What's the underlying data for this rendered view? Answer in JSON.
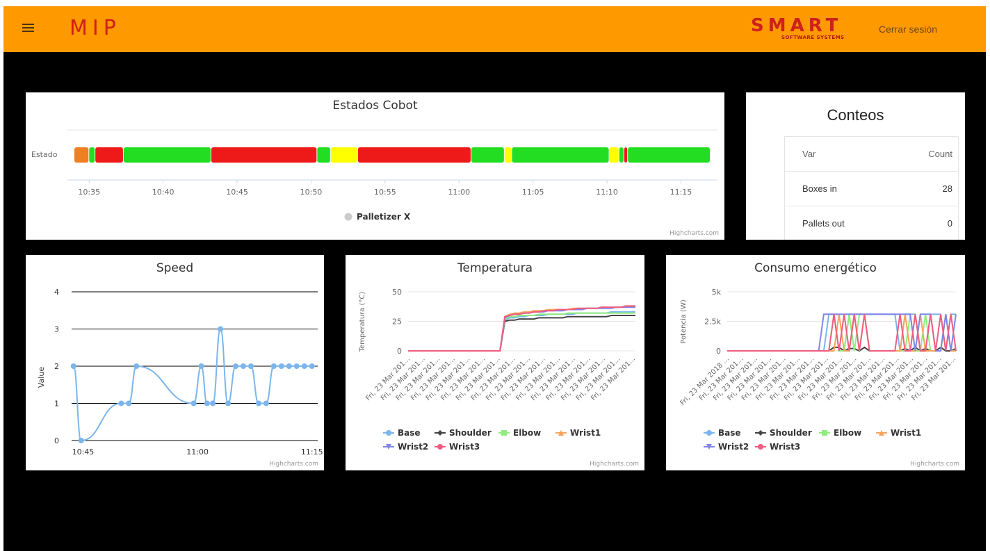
{
  "header": {
    "logo_left": "MIP",
    "logo_right_main": "SMART",
    "logo_right_sub": "Software Systems",
    "logout_label": "Cerrar sesión",
    "bar_color": "#ff9900"
  },
  "estados": {
    "title": "Estados Cobot",
    "category_label": "Estado",
    "legend_label": "Palletizer X",
    "credit": "Highcharts.com",
    "x_ticks": [
      "10:35",
      "10:40",
      "10:45",
      "10:50",
      "10:55",
      "11:00",
      "11:05",
      "11:10",
      "11:15"
    ],
    "chart_data": {
      "type": "bar",
      "orientation": "timeline",
      "x_range": [
        "10:34",
        "11:17"
      ],
      "segments": [
        {
          "start": "10:34:00",
          "end": "10:35:00",
          "color": "#ee7f22"
        },
        {
          "start": "10:35:00",
          "end": "10:35:25",
          "color": "#22dd22"
        },
        {
          "start": "10:35:25",
          "end": "10:37:20",
          "color": "#ee1a1a"
        },
        {
          "start": "10:37:20",
          "end": "10:43:15",
          "color": "#22dd22"
        },
        {
          "start": "10:43:15",
          "end": "10:50:25",
          "color": "#ee1a1a"
        },
        {
          "start": "10:50:25",
          "end": "10:51:20",
          "color": "#22dd22"
        },
        {
          "start": "10:51:20",
          "end": "10:53:10",
          "color": "#ffff00"
        },
        {
          "start": "10:53:10",
          "end": "11:00:50",
          "color": "#ee1a1a"
        },
        {
          "start": "11:00:50",
          "end": "11:03:05",
          "color": "#22dd22"
        },
        {
          "start": "11:03:05",
          "end": "11:03:35",
          "color": "#ffff00"
        },
        {
          "start": "11:03:35",
          "end": "11:10:10",
          "color": "#22dd22"
        },
        {
          "start": "11:10:10",
          "end": "11:10:50",
          "color": "#ffff00"
        },
        {
          "start": "11:10:50",
          "end": "11:11:10",
          "color": "#22dd22"
        },
        {
          "start": "11:11:10",
          "end": "11:11:25",
          "color": "#ee1a1a"
        },
        {
          "start": "11:11:25",
          "end": "11:17:00",
          "color": "#22dd22"
        }
      ]
    }
  },
  "conteos": {
    "title": "Conteos",
    "columns": [
      "Var",
      "Count"
    ],
    "rows": [
      {
        "var": "Boxes in",
        "count": "28"
      },
      {
        "var": "Pallets out",
        "count": "0"
      }
    ]
  },
  "speed": {
    "title": "Speed",
    "ylabel": "Value",
    "credit": "Highcharts.com",
    "chart_data": {
      "type": "line",
      "x_ticks": [
        "10:45",
        "11:00",
        "11:15"
      ],
      "y_ticks": [
        0,
        1,
        2,
        3,
        4
      ],
      "ylim": [
        0,
        4
      ],
      "xlim": [
        "10:43:30",
        "11:15:45"
      ],
      "series": [
        {
          "color": "#7cb5ec",
          "x": [
            "10:43:45",
            "10:44:45",
            "10:50:00",
            "10:51:00",
            "10:52:00",
            "10:59:30",
            "11:00:30",
            "11:01:15",
            "11:02:00",
            "11:03:00",
            "11:04:00",
            "11:05:00",
            "11:06:00",
            "11:07:00",
            "11:08:00",
            "11:09:00",
            "11:10:00",
            "11:11:00",
            "11:12:00",
            "11:13:00",
            "11:14:00",
            "11:15:00"
          ],
          "values": [
            2,
            0,
            1,
            1,
            2,
            1,
            2,
            1,
            1,
            3,
            1,
            2,
            2,
            2,
            1,
            1,
            2,
            2,
            2,
            2,
            2,
            2
          ]
        }
      ]
    }
  },
  "temperatura": {
    "title": "Temperatura",
    "ylabel": "Temperatura (°C)",
    "credit": "Highcharts.com",
    "x_tick_label": "Fri, 23 Mar 201...",
    "x_tick_count": 16,
    "legend": [
      {
        "name": "Base",
        "color": "#7cb5ec",
        "marker": "circle"
      },
      {
        "name": "Shoulder",
        "color": "#434348",
        "marker": "diamond"
      },
      {
        "name": "Elbow",
        "color": "#90ed7d",
        "marker": "square"
      },
      {
        "name": "Wrist1",
        "color": "#f7a35c",
        "marker": "triangle"
      },
      {
        "name": "Wrist2",
        "color": "#8085e9",
        "marker": "triangle-down"
      },
      {
        "name": "Wrist3",
        "color": "#f15c80",
        "marker": "circle"
      }
    ],
    "chart_data": {
      "type": "line",
      "y_ticks": [
        0,
        25,
        50
      ],
      "ylim": [
        0,
        50
      ],
      "series": [
        {
          "name": "Base",
          "values": [
            0,
            0,
            0,
            0,
            0,
            0,
            0,
            0,
            0,
            0,
            0,
            0,
            0,
            0,
            0,
            0,
            0,
            0,
            0,
            0,
            26,
            28,
            28,
            29,
            29,
            30,
            30,
            30,
            30,
            31,
            31,
            31,
            31,
            31,
            31,
            32,
            32,
            32,
            32,
            32,
            32,
            32,
            33,
            33,
            33,
            33,
            33,
            33
          ]
        },
        {
          "name": "Shoulder",
          "values": [
            0,
            0,
            0,
            0,
            0,
            0,
            0,
            0,
            0,
            0,
            0,
            0,
            0,
            0,
            0,
            0,
            0,
            0,
            0,
            0,
            25,
            26,
            26,
            27,
            27,
            27,
            27,
            28,
            28,
            28,
            28,
            28,
            28,
            29,
            29,
            29,
            29,
            29,
            29,
            29,
            29,
            29,
            30,
            30,
            30,
            30,
            30,
            30
          ]
        },
        {
          "name": "Elbow",
          "values": [
            0,
            0,
            0,
            0,
            0,
            0,
            0,
            0,
            0,
            0,
            0,
            0,
            0,
            0,
            0,
            0,
            0,
            0,
            0,
            0,
            27,
            29,
            29,
            30,
            30,
            30,
            30,
            31,
            31,
            31,
            31,
            31,
            31,
            32,
            32,
            32,
            32,
            32,
            32,
            32,
            32,
            32,
            32,
            32,
            32,
            32,
            32,
            32
          ]
        },
        {
          "name": "Wrist1",
          "values": [
            0,
            0,
            0,
            0,
            0,
            0,
            0,
            0,
            0,
            0,
            0,
            0,
            0,
            0,
            0,
            0,
            0,
            0,
            0,
            0,
            29,
            31,
            32,
            32,
            33,
            33,
            34,
            34,
            34,
            35,
            35,
            35,
            35,
            35,
            36,
            36,
            36,
            36,
            36,
            36,
            37,
            37,
            37,
            37,
            37,
            38,
            38,
            38
          ]
        },
        {
          "name": "Wrist2",
          "values": [
            0,
            0,
            0,
            0,
            0,
            0,
            0,
            0,
            0,
            0,
            0,
            0,
            0,
            0,
            0,
            0,
            0,
            0,
            0,
            0,
            28,
            30,
            31,
            31,
            32,
            32,
            33,
            33,
            33,
            34,
            34,
            34,
            34,
            35,
            35,
            35,
            35,
            36,
            36,
            36,
            36,
            36,
            36,
            37,
            37,
            37,
            37,
            37
          ]
        },
        {
          "name": "Wrist3",
          "values": [
            0,
            0,
            0,
            0,
            0,
            0,
            0,
            0,
            0,
            0,
            0,
            0,
            0,
            0,
            0,
            0,
            0,
            0,
            0,
            0,
            29,
            30,
            31,
            31,
            32,
            32,
            33,
            33,
            34,
            34,
            34,
            35,
            35,
            35,
            35,
            36,
            36,
            36,
            36,
            36,
            37,
            37,
            37,
            37,
            37,
            38,
            38,
            38
          ]
        }
      ]
    }
  },
  "consumo": {
    "title": "Consumo energético",
    "ylabel": "Potencia (W)",
    "credit": "Highcharts.com",
    "first_tick_label": "Fri, 23 Mar 2018 ...",
    "x_tick_label": "Fri, 23 Mar 201...",
    "x_tick_count": 17,
    "legend": [
      {
        "name": "Base",
        "color": "#7cb5ec",
        "marker": "circle"
      },
      {
        "name": "Shoulder",
        "color": "#434348",
        "marker": "diamond"
      },
      {
        "name": "Elbow",
        "color": "#90ed7d",
        "marker": "square"
      },
      {
        "name": "Wrist1",
        "color": "#f7a35c",
        "marker": "triangle"
      },
      {
        "name": "Wrist2",
        "color": "#8085e9",
        "marker": "triangle-down"
      },
      {
        "name": "Wrist3",
        "color": "#f15c80",
        "marker": "circle"
      }
    ],
    "chart_data": {
      "type": "line",
      "y_tick_labels": [
        "0",
        "2.5k",
        "5k"
      ],
      "y_ticks": [
        0,
        2500,
        5000
      ],
      "ylim": [
        0,
        5000
      ],
      "series": [
        {
          "name": "Base",
          "values": [
            0,
            0,
            0,
            0,
            0,
            0,
            0,
            0,
            0,
            0,
            0,
            0,
            0,
            0,
            0,
            0,
            0,
            0,
            0,
            0,
            3100,
            3100,
            0,
            0,
            3100,
            3100,
            3100,
            3100,
            3100,
            3100,
            3100,
            3100,
            3100,
            3100,
            0,
            3100,
            3100,
            3100,
            0,
            0,
            3100,
            3100,
            3100,
            0,
            3100,
            3100
          ]
        },
        {
          "name": "Shoulder",
          "values": [
            0,
            0,
            0,
            0,
            0,
            0,
            0,
            0,
            0,
            0,
            0,
            0,
            0,
            0,
            0,
            0,
            0,
            0,
            0,
            0,
            0,
            300,
            300,
            0,
            200,
            200,
            0,
            300,
            0,
            0,
            0,
            0,
            0,
            0,
            0,
            200,
            0,
            300,
            0,
            200,
            0,
            0,
            300,
            0,
            0,
            200
          ]
        },
        {
          "name": "Elbow",
          "values": [
            0,
            0,
            0,
            0,
            0,
            0,
            0,
            0,
            0,
            0,
            0,
            0,
            0,
            0,
            0,
            0,
            0,
            0,
            0,
            0,
            0,
            3100,
            0,
            0,
            3100,
            0,
            3100,
            3100,
            0,
            0,
            0,
            0,
            0,
            0,
            0,
            0,
            3100,
            0,
            0,
            3100,
            0,
            0,
            0,
            3100,
            0,
            0
          ]
        },
        {
          "name": "Wrist1",
          "values": [
            0,
            0,
            0,
            0,
            0,
            0,
            0,
            0,
            0,
            0,
            0,
            0,
            0,
            0,
            0,
            0,
            0,
            0,
            0,
            0,
            0,
            0,
            3100,
            0,
            0,
            3100,
            0,
            3100,
            0,
            0,
            0,
            0,
            0,
            0,
            0,
            3100,
            0,
            0,
            3100,
            0,
            0,
            0,
            0,
            3100,
            0,
            0
          ]
        },
        {
          "name": "Wrist2",
          "values": [
            0,
            0,
            0,
            0,
            0,
            0,
            0,
            0,
            0,
            0,
            0,
            0,
            0,
            0,
            0,
            0,
            0,
            0,
            0,
            3100,
            3100,
            3100,
            3100,
            3100,
            3100,
            3100,
            3100,
            3100,
            3100,
            3100,
            3100,
            3100,
            3100,
            3100,
            3100,
            3100,
            3100,
            0,
            3100,
            3100,
            3100,
            0,
            0,
            3100,
            0,
            3100
          ]
        },
        {
          "name": "Wrist3",
          "values": [
            0,
            0,
            0,
            0,
            0,
            0,
            0,
            0,
            0,
            0,
            0,
            0,
            0,
            0,
            0,
            0,
            0,
            0,
            0,
            0,
            0,
            3100,
            0,
            3100,
            0,
            3100,
            0,
            3100,
            0,
            0,
            0,
            0,
            0,
            0,
            3100,
            0,
            0,
            3100,
            0,
            0,
            3100,
            0,
            3100,
            0,
            3100,
            0
          ]
        }
      ]
    }
  }
}
